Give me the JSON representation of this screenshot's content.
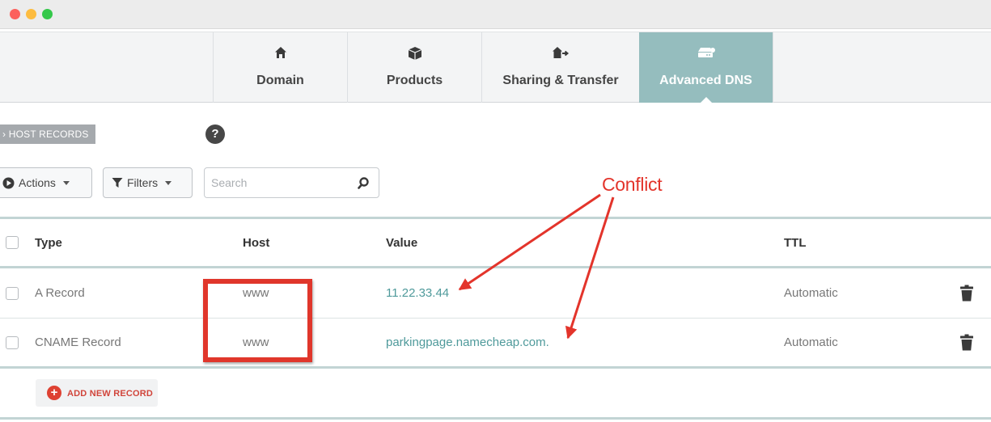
{
  "tabs": [
    {
      "label": "Domain",
      "icon": "home-icon",
      "active": false
    },
    {
      "label": "Products",
      "icon": "box-icon",
      "active": false
    },
    {
      "label": "Sharing & Transfer",
      "icon": "share-transfer-icon",
      "active": false
    },
    {
      "label": "Advanced DNS",
      "icon": "dns-server-icon",
      "active": true
    }
  ],
  "host_records": {
    "section_label": "HOST RECORDS",
    "help": "?"
  },
  "toolbar": {
    "actions_label": "Actions",
    "filters_label": "Filters",
    "search_placeholder": "Search"
  },
  "table": {
    "headers": {
      "type": "Type",
      "host": "Host",
      "value": "Value",
      "ttl": "TTL"
    },
    "rows": [
      {
        "type": "A Record",
        "host": "www",
        "value": "11.22.33.44",
        "ttl": "Automatic"
      },
      {
        "type": "CNAME Record",
        "host": "www",
        "value": "parkingpage.namecheap.com.",
        "ttl": "Automatic"
      }
    ]
  },
  "add_record": {
    "label": "ADD NEW RECORD"
  },
  "annotation": {
    "label": "Conflict",
    "color": "#e3342b"
  },
  "colors": {
    "active_tab": "#95bdbe",
    "accent_red": "#de4132",
    "value_teal": "#4f9a9b"
  }
}
